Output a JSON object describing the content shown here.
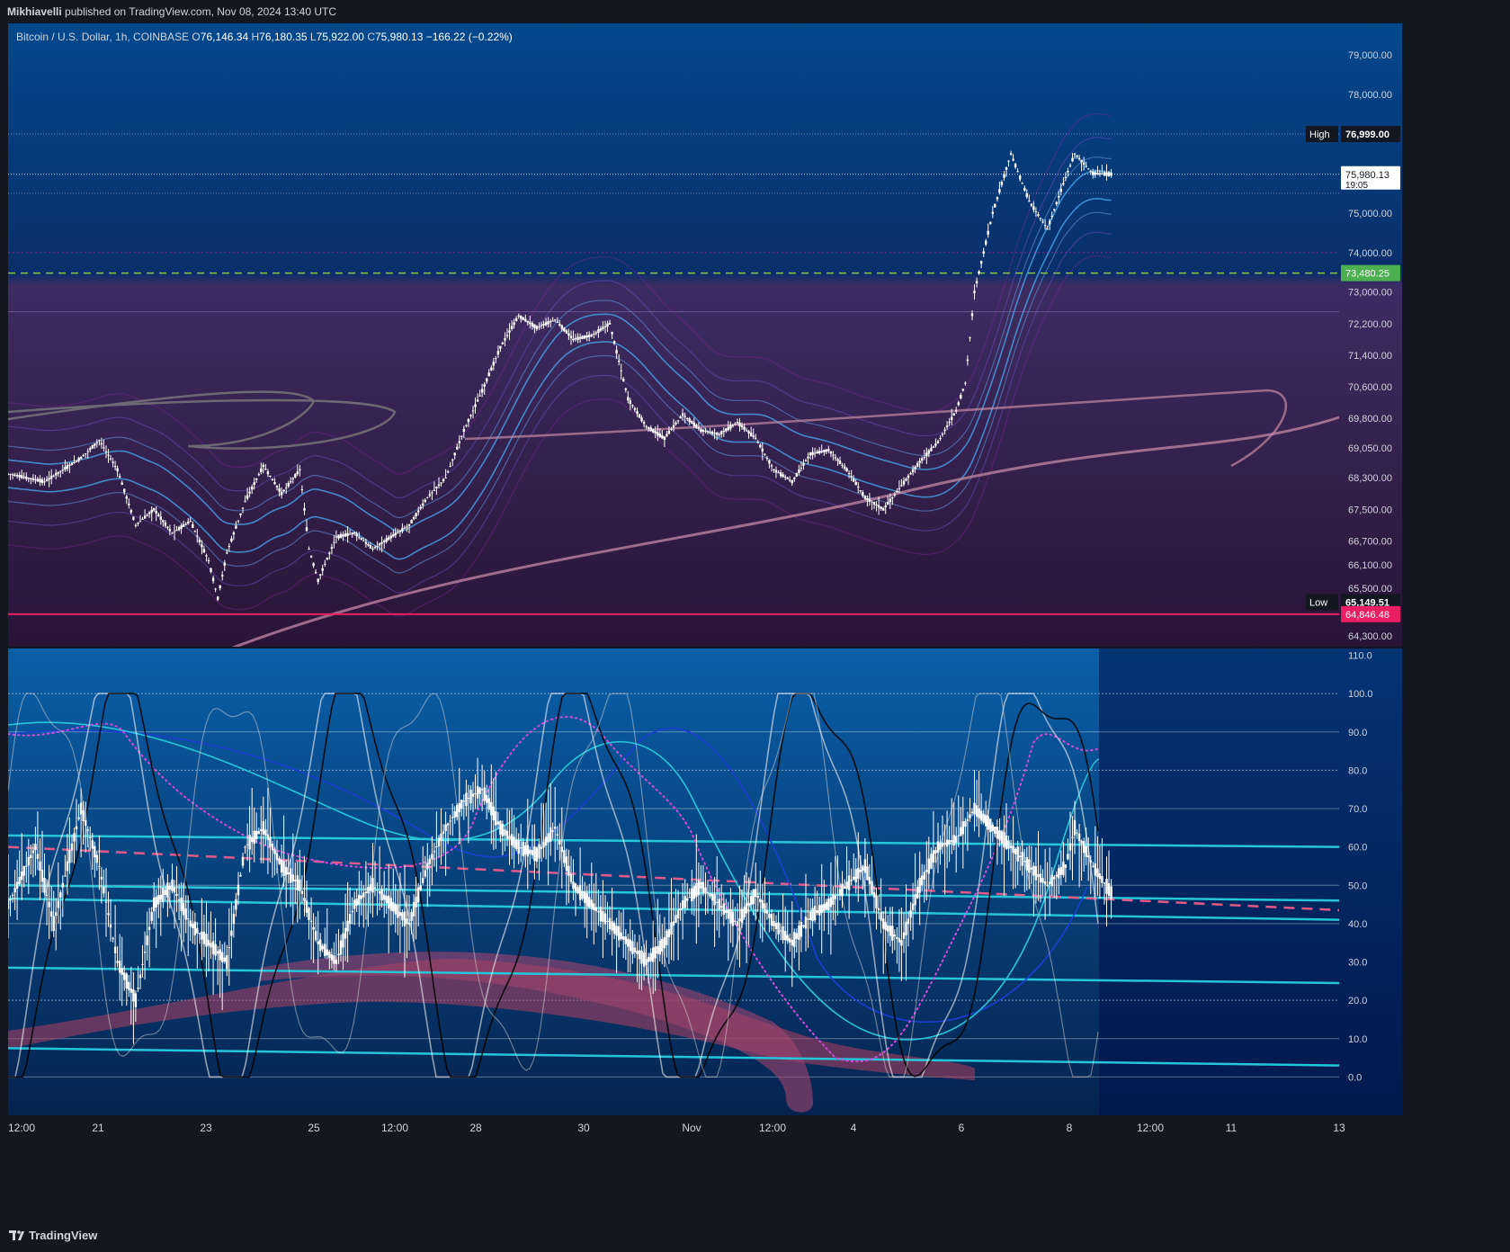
{
  "header": {
    "author": "Mikhiavelli",
    "published_text": "published on TradingView.com, Nov 08, 2024 13:40 UTC"
  },
  "legend": {
    "symbol": "Bitcoin / U.S. Dollar, 1h, COINBASE",
    "o_label": "O",
    "o_value": "76,146.34",
    "h_label": "H",
    "h_value": "76,180.35",
    "l_label": "L",
    "l_value": "75,922.00",
    "c_label": "C",
    "c_value": "75,980.13",
    "change": "−166.22 (−0.22%)"
  },
  "footer": {
    "brand": "TradingView"
  },
  "colors": {
    "bg_top": "#03407e",
    "bg_mid": "#3a2a5a",
    "bg_bottom": "#2b1638",
    "candle": "#ffffff",
    "accent_green": "#4caf50",
    "accent_red": "#e91e63",
    "cyan": "#26c6da",
    "band_blue": "#5d8fd6",
    "pink_dash": "#e05a8a",
    "dotted_magenta": "#d24bdb"
  },
  "chart_data": [
    {
      "type": "candlestick",
      "title": "Bitcoin / U.S. Dollar, 1h, COINBASE",
      "ylim": [
        64000,
        79800
      ],
      "y_ticks": [
        "79,000.00",
        "78,000.00",
        "75,000.00",
        "74,000.00",
        "73,000.00",
        "72,200.00",
        "71,400.00",
        "70,600.00",
        "69,800.00",
        "69,050.00",
        "68,300.00",
        "67,500.00",
        "66,700.00",
        "66,100.00",
        "65,500.00",
        "64,300.00"
      ],
      "y_tick_values": [
        79000,
        78000,
        75000,
        74000,
        73000,
        72200,
        71400,
        70600,
        69800,
        69050,
        68300,
        67500,
        66700,
        66100,
        65500,
        64300
      ],
      "x_ticks": [
        "12:00",
        "21",
        "23",
        "25",
        "12:00",
        "28",
        "30",
        "Nov",
        "12:00",
        "4",
        "6",
        "8",
        "12:00",
        "11",
        "13"
      ],
      "price_path": [
        [
          0,
          68400
        ],
        [
          4,
          68200
        ],
        [
          8,
          68800
        ],
        [
          10,
          69250
        ],
        [
          12,
          68500
        ],
        [
          14,
          67100
        ],
        [
          16,
          67500
        ],
        [
          18,
          66900
        ],
        [
          20,
          67200
        ],
        [
          22,
          66200
        ],
        [
          23,
          65250
        ],
        [
          24,
          66400
        ],
        [
          26,
          67700
        ],
        [
          28,
          68600
        ],
        [
          30,
          67900
        ],
        [
          32,
          68500
        ],
        [
          33,
          66500
        ],
        [
          34,
          65700
        ],
        [
          36,
          66800
        ],
        [
          38,
          66900
        ],
        [
          40,
          66500
        ],
        [
          42,
          66800
        ],
        [
          44,
          67100
        ],
        [
          46,
          67800
        ],
        [
          48,
          68300
        ],
        [
          50,
          69500
        ],
        [
          52,
          70500
        ],
        [
          54,
          71600
        ],
        [
          56,
          72400
        ],
        [
          58,
          72100
        ],
        [
          60,
          72300
        ],
        [
          62,
          71800
        ],
        [
          64,
          71900
        ],
        [
          66,
          72200
        ],
        [
          68,
          70300
        ],
        [
          70,
          69600
        ],
        [
          72,
          69300
        ],
        [
          74,
          69900
        ],
        [
          76,
          69500
        ],
        [
          78,
          69400
        ],
        [
          80,
          69700
        ],
        [
          82,
          69300
        ],
        [
          84,
          68500
        ],
        [
          86,
          68200
        ],
        [
          88,
          68900
        ],
        [
          90,
          69000
        ],
        [
          92,
          68500
        ],
        [
          94,
          67800
        ],
        [
          96,
          67500
        ],
        [
          98,
          68100
        ],
        [
          100,
          68700
        ],
        [
          102,
          69200
        ],
        [
          104,
          70000
        ],
        [
          105,
          70700
        ],
        [
          106,
          73000
        ],
        [
          108,
          75000
        ],
        [
          110,
          76500
        ],
        [
          112,
          75300
        ],
        [
          114,
          74600
        ],
        [
          116,
          75900
        ],
        [
          117,
          76500
        ],
        [
          119,
          76000
        ],
        [
          121,
          75980
        ]
      ],
      "x_range": [
        0,
        146
      ],
      "levels": [
        {
          "label": "High",
          "value": 76999.0,
          "value_text": "76,999.00"
        },
        {
          "label": "",
          "value": 75980.13,
          "value_text": "75,980.13",
          "sub": "19:05"
        },
        {
          "label": "",
          "value": 73480.25,
          "value_text": "73,480.25"
        },
        {
          "label": "Low",
          "value": 65149.51,
          "value_text": "65,149.51"
        },
        {
          "label": "",
          "value": 64846.48,
          "value_text": "64,846.48"
        }
      ]
    },
    {
      "type": "line",
      "ylim": [
        -10,
        112
      ],
      "y_ticks": [
        "110.0",
        "100.0",
        "90.0",
        "80.0",
        "70.0",
        "60.0",
        "50.0",
        "40.0",
        "30.0",
        "20.0",
        "10.0",
        "0.0"
      ],
      "y_tick_values": [
        110,
        100,
        90,
        80,
        70,
        60,
        50,
        40,
        30,
        20,
        10,
        0
      ],
      "oscillator_path": [
        [
          0,
          45
        ],
        [
          3,
          60
        ],
        [
          5,
          40
        ],
        [
          8,
          70
        ],
        [
          10,
          55
        ],
        [
          12,
          30
        ],
        [
          14,
          20
        ],
        [
          16,
          45
        ],
        [
          18,
          50
        ],
        [
          20,
          40
        ],
        [
          22,
          35
        ],
        [
          24,
          30
        ],
        [
          26,
          60
        ],
        [
          28,
          65
        ],
        [
          30,
          55
        ],
        [
          32,
          50
        ],
        [
          34,
          35
        ],
        [
          36,
          30
        ],
        [
          38,
          45
        ],
        [
          40,
          50
        ],
        [
          42,
          45
        ],
        [
          44,
          40
        ],
        [
          46,
          55
        ],
        [
          48,
          65
        ],
        [
          50,
          72
        ],
        [
          52,
          75
        ],
        [
          54,
          65
        ],
        [
          56,
          60
        ],
        [
          58,
          58
        ],
        [
          60,
          65
        ],
        [
          62,
          50
        ],
        [
          64,
          45
        ],
        [
          66,
          40
        ],
        [
          68,
          35
        ],
        [
          70,
          30
        ],
        [
          72,
          35
        ],
        [
          74,
          45
        ],
        [
          76,
          50
        ],
        [
          78,
          45
        ],
        [
          80,
          40
        ],
        [
          82,
          48
        ],
        [
          84,
          40
        ],
        [
          86,
          35
        ],
        [
          88,
          42
        ],
        [
          90,
          45
        ],
        [
          92,
          50
        ],
        [
          94,
          55
        ],
        [
          96,
          40
        ],
        [
          98,
          35
        ],
        [
          100,
          50
        ],
        [
          102,
          60
        ],
        [
          104,
          62
        ],
        [
          106,
          70
        ],
        [
          108,
          65
        ],
        [
          110,
          60
        ],
        [
          112,
          55
        ],
        [
          114,
          50
        ],
        [
          116,
          55
        ],
        [
          117,
          65
        ],
        [
          119,
          55
        ],
        [
          121,
          48
        ]
      ],
      "x_range": [
        0,
        146
      ]
    }
  ]
}
